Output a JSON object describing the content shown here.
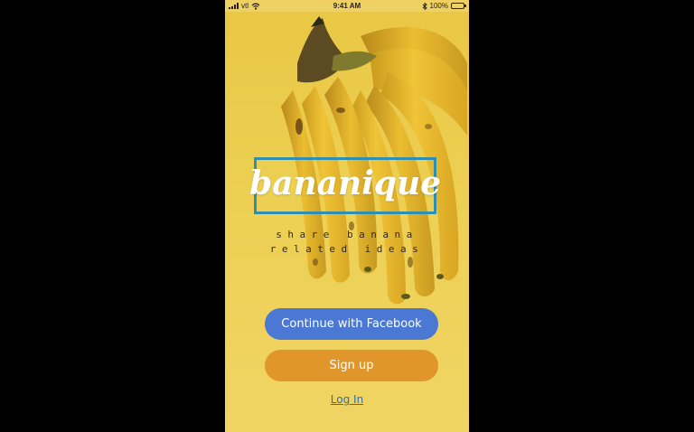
{
  "status_bar": {
    "carrier": "vtl",
    "time": "9:41 AM",
    "battery": "100%",
    "signal_icon": "signal-bars-icon",
    "wifi_icon": "wifi-icon",
    "bluetooth_icon": "bluetooth-icon",
    "battery_icon": "battery-icon"
  },
  "brand": {
    "logo": "bananique",
    "tagline_line1": "share banana",
    "tagline_line2": "related ideas"
  },
  "actions": {
    "facebook_label": "Continue with Facebook",
    "signup_label": "Sign up",
    "login_label": "Log In"
  },
  "colors": {
    "background": "#e9c744",
    "logo_border": "#2e8fb0",
    "facebook_button": "#4a78d3",
    "signup_button": "#e0962a",
    "login_link": "#2f6fb0"
  }
}
